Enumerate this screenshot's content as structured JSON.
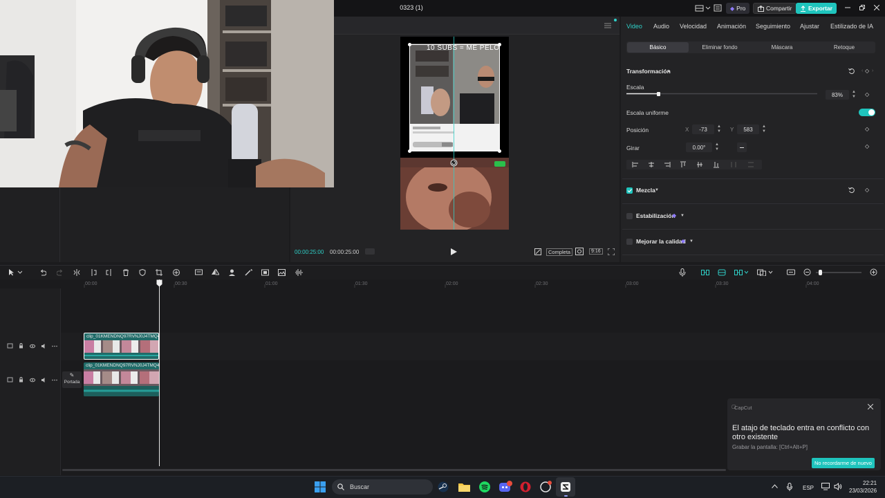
{
  "window": {
    "project_title": "0323 (1)",
    "pro_label": "Pro",
    "share_label": "Compartir",
    "export_label": "Exportar"
  },
  "player": {
    "current_time": "00:00:25:00",
    "total_time": "00:00:25:00",
    "fit_label": "Completa",
    "ratio_label": "9:16",
    "overlay_text": "10 SUBS = ME PELO"
  },
  "panel": {
    "tabs": [
      "Video",
      "Audio",
      "Velocidad",
      "Animación",
      "Seguimiento",
      "Ajustar",
      "Estilizado de IA"
    ],
    "subtabs": [
      "Básico",
      "Eliminar fondo",
      "Máscara",
      "Retoque"
    ],
    "transform_title": "Transformación",
    "scale_label": "Escala",
    "scale_value": "83%",
    "scale_fraction": 0.83,
    "uniform_scale_label": "Escala uniforme",
    "position_label": "Posición",
    "x_axis": "X",
    "x_value": "-73",
    "y_axis": "Y",
    "y_value": "583",
    "rotate_label": "Girar",
    "rotate_value": "0.00°",
    "blend_label": "Mezcla",
    "stabilization_label": "Estabilización",
    "quality_label": "Mejorar la calidad"
  },
  "timeline": {
    "ticks": [
      "00:00",
      "00:30",
      "01:00",
      "01:30",
      "02:00",
      "02:30",
      "03:00",
      "03:30",
      "04:00"
    ],
    "clip1_name": "clip_01KMENDNQ97RVNJ0J4TMQ4",
    "clip2_name": "clip_01KMENDNQ97RVNJ0J4TMQ4",
    "cover_label": "Portada"
  },
  "toast": {
    "app": "CapCut",
    "title": "El atajo de teclado entra en conflicto con otro existente",
    "body": "Grabar la pantalla: [Ctrl+Alt+P]",
    "button": "No recordarme de nuevo"
  },
  "taskbar": {
    "search_placeholder": "Buscar",
    "lang": "ESP",
    "time": "22:21",
    "date": "23/03/2026"
  },
  "colors": {
    "accent": "#2fd0c8",
    "export": "#1fc4bd"
  }
}
